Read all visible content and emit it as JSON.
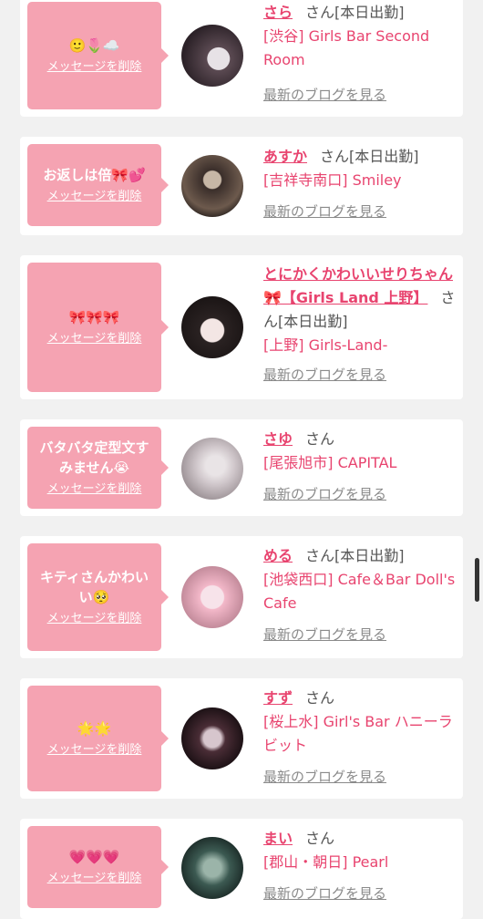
{
  "delete_label": "メッセージを削除",
  "san_suffix": "さん",
  "blog_label": "最新のブログを見る",
  "cards": [
    {
      "message": "🙂🌷☁️",
      "name": "さら",
      "status": "[本日出勤]",
      "shop": "[渋谷] Girls Bar Second Room"
    },
    {
      "message": "お返しは倍🎀💕",
      "name": "あすか",
      "status": "[本日出勤]",
      "shop": "[吉祥寺南口] Smiley"
    },
    {
      "message": "🎀🎀🎀",
      "name": "とにかくかわいいせりちゃん🎀【Girls Land 上野】",
      "status": "[本日出勤]",
      "shop": "[上野] Girls-Land-"
    },
    {
      "message": "バタバタ定型文すみません😭",
      "name": "さゆ",
      "status": "",
      "shop": "[尾張旭市] CAPITAL"
    },
    {
      "message": "キティさんかわいい🥺",
      "name": "める",
      "status": "[本日出勤]",
      "shop": "[池袋西口] Cafe＆Bar Doll's Cafe"
    },
    {
      "message": "🌟🌟",
      "name": "すず",
      "status": "",
      "shop": "[桜上水] Girl's Bar ハニーラビット"
    },
    {
      "message": "💗💗💗",
      "name": "まい",
      "status": "",
      "shop": "[郡山・朝日] Pearl"
    }
  ],
  "colors": {
    "accent": "#e8446f",
    "bubble": "#f5a3b2",
    "background": "#f1f1f1"
  }
}
